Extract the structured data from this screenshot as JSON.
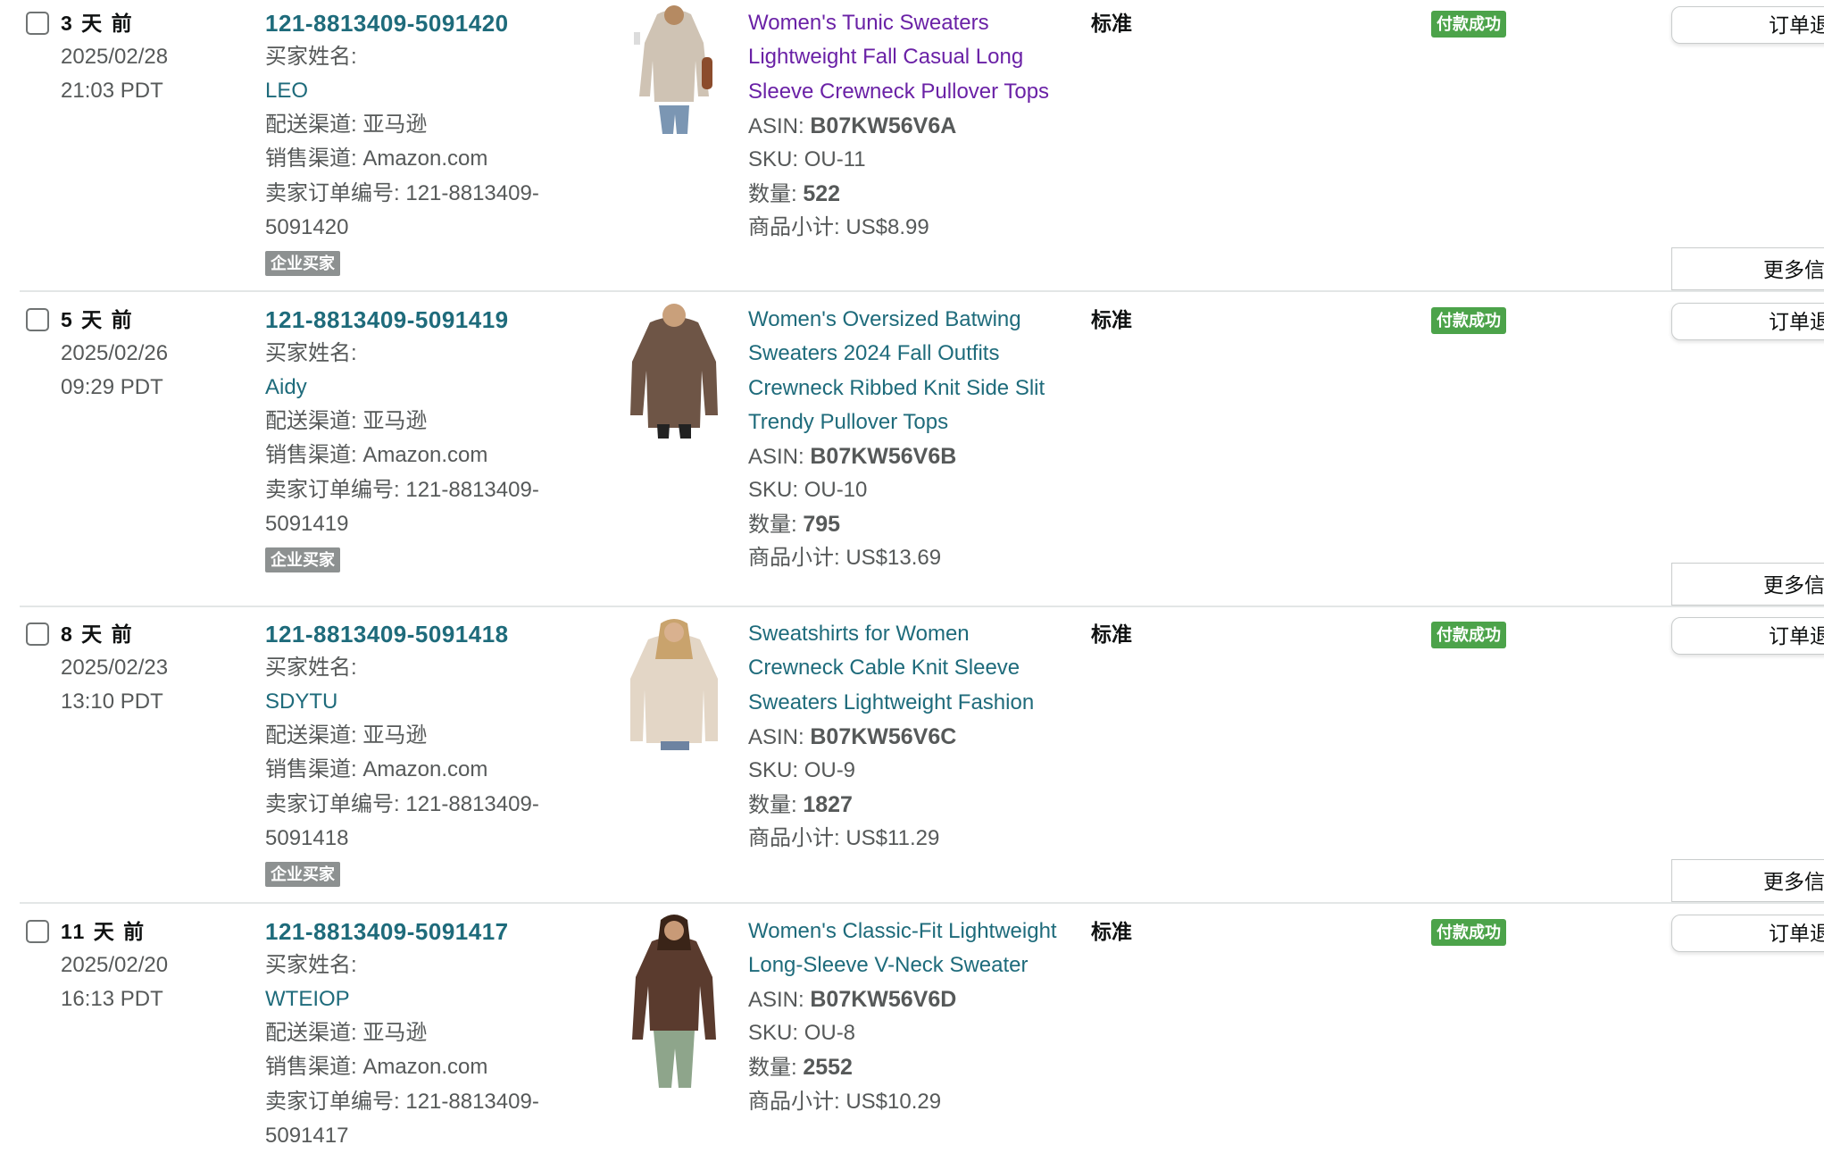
{
  "labels": {
    "buyer_name": "买家姓名:",
    "fulfillment": "配送渠道: 亚马逊",
    "sales_channel": "销售渠道: Amazon.com",
    "seller_order_no": "卖家订单编号: ",
    "business_buyer": "企业买家",
    "asin": "ASIN: ",
    "sku": "SKU: ",
    "quantity": "数量: ",
    "subtotal": "商品小计: ",
    "shipping_service": "标准",
    "payment_status": "付款成功",
    "refund_button": "订单退",
    "more_info_button": "更多信"
  },
  "colors": {
    "link": "#1e6b7b",
    "visited_link": "#6a21a6",
    "paid_badge": "#4ca34a",
    "business_badge": "#8d9191"
  },
  "orders": [
    {
      "age": "3 天 前",
      "date": "2025/02/28",
      "time": "21:03 PDT",
      "order_id": "121-8813409-5091420",
      "buyer": "LEO",
      "seller_order_no_a": "121-8813409-",
      "seller_order_no_b": "5091420",
      "title_lines": [
        "Women's Tunic Sweaters",
        "Lightweight Fall Casual Long",
        "Sleeve Crewneck Pullover Tops"
      ],
      "asin": "B07KW56V6A",
      "sku": "OU-11",
      "quantity": "522",
      "subtotal": "US$8.99"
    },
    {
      "age": "5 天 前",
      "date": "2025/02/26",
      "time": "09:29 PDT",
      "order_id": "121-8813409-5091419",
      "buyer": "Aidy",
      "seller_order_no_a": "121-8813409-",
      "seller_order_no_b": "5091419",
      "title_lines": [
        "Women's Oversized Batwing",
        "Sweaters 2024 Fall Outfits",
        "Crewneck Ribbed Knit Side Slit",
        "Trendy Pullover Tops"
      ],
      "asin": "B07KW56V6B",
      "sku": "OU-10",
      "quantity": "795",
      "subtotal": "US$13.69"
    },
    {
      "age": "8 天 前",
      "date": "2025/02/23",
      "time": "13:10 PDT",
      "order_id": "121-8813409-5091418",
      "buyer": "SDYTU",
      "seller_order_no_a": "121-8813409-",
      "seller_order_no_b": "5091418",
      "title_lines": [
        "Sweatshirts for Women",
        "Crewneck Cable Knit Sleeve",
        "Sweaters Lightweight Fashion"
      ],
      "asin": "B07KW56V6C",
      "sku": "OU-9",
      "quantity": "1827",
      "subtotal": "US$11.29"
    },
    {
      "age": "11 天 前",
      "date": "2025/02/20",
      "time": "16:13 PDT",
      "order_id": "121-8813409-5091417",
      "buyer": "WTEIOP",
      "seller_order_no_a": "121-8813409-",
      "seller_order_no_b": "5091417",
      "title_lines": [
        "Women's Classic-Fit Lightweight",
        "Long-Sleeve V-Neck Sweater"
      ],
      "asin": "B07KW56V6D",
      "sku": "OU-8",
      "quantity": "2552",
      "subtotal": "US$10.29"
    }
  ]
}
